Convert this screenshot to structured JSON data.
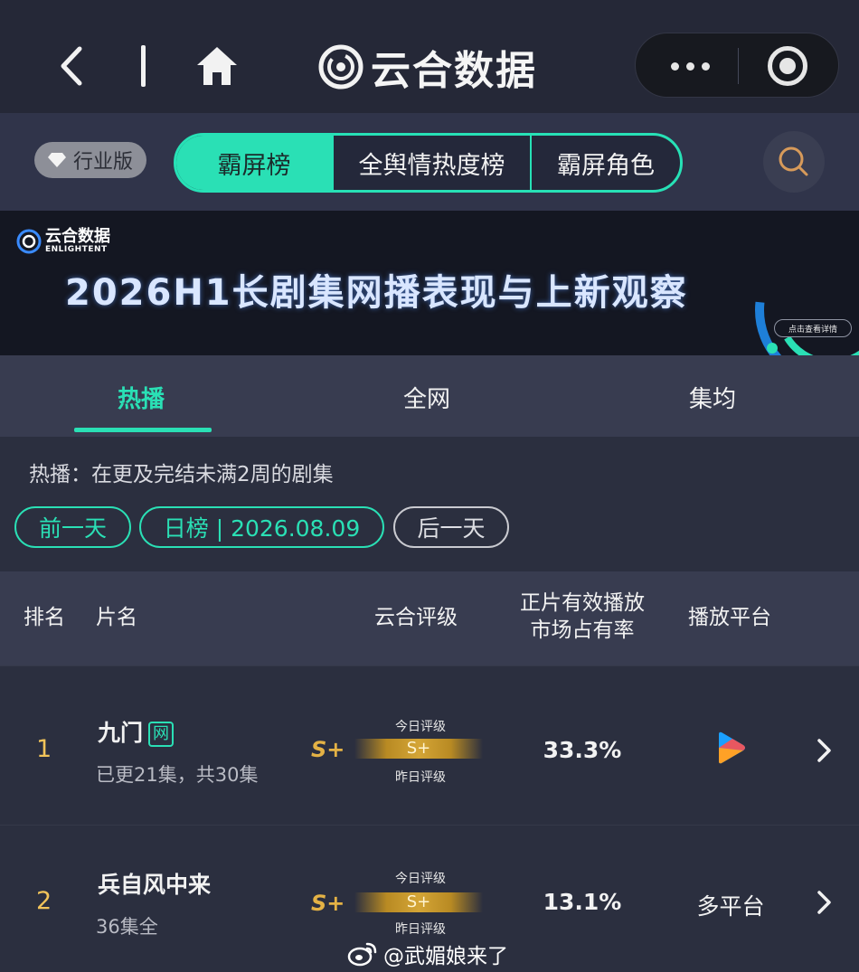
{
  "app": {
    "brand_name": "云合数据",
    "edition_badge": "行业版"
  },
  "top_tabs": [
    {
      "label": "霸屏榜",
      "active": true
    },
    {
      "label": "全舆情热度榜",
      "active": false
    },
    {
      "label": "霸屏角色",
      "active": false
    }
  ],
  "banner": {
    "brand": "云合数据",
    "brand_sub": "ENLIGHTENT",
    "title": "2026H1长剧集网播表现与上新观察",
    "cta": "点击查看详情"
  },
  "section_tabs": [
    {
      "label": "热播",
      "active": true
    },
    {
      "label": "全网",
      "active": false
    },
    {
      "label": "集均",
      "active": false
    }
  ],
  "description": "热播：在更及完结未满2周的剧集",
  "date_nav": {
    "prev": "前一天",
    "current": "日榜 | 2026.08.09",
    "next": "后一天"
  },
  "table": {
    "headers": {
      "rank": "排名",
      "title": "片名",
      "grade": "云合评级",
      "share_line1": "正片有效播放",
      "share_line2": "市场占有率",
      "platform": "播放平台"
    },
    "grade_today_caption": "今日评级",
    "grade_yesterday_caption": "昨日评级",
    "rows": [
      {
        "rank": "1",
        "title": "九门",
        "badge": "网",
        "episodes": "已更21集，共30集",
        "grade_yesterday": "S+",
        "grade_today": "S+",
        "share": "33.3%",
        "platform": "",
        "platform_icon": "youku-play-icon"
      },
      {
        "rank": "2",
        "title": "兵自风中来",
        "badge": "",
        "episodes": "36集全",
        "grade_yesterday": "S+",
        "grade_today": "S+",
        "share": "13.1%",
        "platform": "多平台",
        "platform_icon": ""
      }
    ]
  },
  "watermark": {
    "weibo_handle": "@武媚娘来了"
  },
  "colors": {
    "accent": "#2ae0b5",
    "gold": "#e4b245",
    "background": "#2b2f3f",
    "header_bg": "#383c50"
  }
}
